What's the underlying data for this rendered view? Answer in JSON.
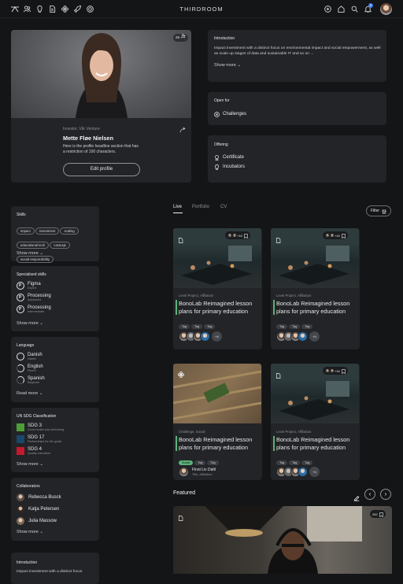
{
  "app": {
    "title": "THIRDROOM"
  },
  "nav": {
    "notification_count": "6"
  },
  "profile": {
    "badge": "28",
    "role": "Investor, Vår Venture",
    "name": "Mette Fløe Nielsen",
    "headline": "Here is the profile headline section that has a restriction of 100 characters.",
    "edit_label": "Edit profile"
  },
  "intro": {
    "title": "Introduction",
    "text": "Impact investment with a distinct focus on environmental impact and social empowerment, as well as scale up stages of data and sustainable IT and so on ...",
    "show_more": "Show more"
  },
  "open_for": {
    "title": "Open for",
    "items": [
      "Challenges"
    ]
  },
  "offering": {
    "title": "Offering",
    "items": [
      "Certificate",
      "Incubators"
    ]
  },
  "skills": {
    "title": "Skills",
    "tags": [
      "impact",
      "investment",
      "scaling",
      "educational tech",
      "cactusjs",
      "social responsibility"
    ],
    "show_more": "Show more"
  },
  "specialised": {
    "title": "Specialised skills",
    "items": [
      {
        "name": "Figma",
        "level": "Expert"
      },
      {
        "name": "Processing",
        "level": "Advanced"
      },
      {
        "name": "Processing",
        "level": "Intermediate"
      }
    ],
    "show_more": "Show more"
  },
  "language": {
    "title": "Language",
    "items": [
      {
        "name": "Danish",
        "level": "Native"
      },
      {
        "name": "English",
        "level": "Fluent"
      },
      {
        "name": "Spanish",
        "level": "Beginner"
      }
    ],
    "show_more": "Read more"
  },
  "sdg": {
    "title": "UN SDG Classification",
    "items": [
      {
        "name": "SDG 3",
        "desc": "Good health and well-being",
        "color": "#4c9f38"
      },
      {
        "name": "SDG 17",
        "desc": "Partnerships for the goals",
        "color": "#19486a"
      },
      {
        "name": "SDG 4",
        "desc": "Quality education",
        "color": "#c5192d"
      }
    ],
    "show_more": "Show more"
  },
  "collaborators": {
    "title": "Collaborators",
    "items": [
      "Rebecca Busck",
      "Katja Petersen",
      "Julia Massow"
    ],
    "show_more": "Show more"
  },
  "intro2": {
    "title": "Introduction",
    "text": "Impact investment with a distinct focus"
  },
  "tabs": [
    "Live",
    "Portfolio",
    "CV"
  ],
  "filter_label": "Filter",
  "projects": [
    {
      "type": "Level Project, Affiliation",
      "title": "BonoLab Reimagined lesson plans for primary education",
      "count": "+16",
      "tags": [
        "Tag",
        "Tag",
        "Tag"
      ],
      "more": "+4"
    },
    {
      "type": "Level Project, Affiliation",
      "title": "BonoLab Reimagined lesson plans for primary education",
      "count": "+16",
      "tags": [
        "Tag",
        "Tag",
        "Tag"
      ],
      "more": "+4"
    },
    {
      "type": "Challenge, Social",
      "title": "BonoLab Reimagined lesson plans for primary education",
      "tags": [
        "Social",
        "Tag",
        "Tag"
      ],
      "person": "Finst Liv Dahl",
      "person_sub": "Title, Affiliation"
    },
    {
      "type": "Level Project, Affiliation",
      "title": "BonoLab Reimagined lesson plans for primary education",
      "count": "+16",
      "tags": [
        "Tag",
        "Tag",
        "Tag"
      ],
      "more": "+4"
    }
  ],
  "featured": {
    "title": "Featured",
    "count": "282"
  },
  "colors": {
    "accent": "#5bb27b",
    "bg": "#141517",
    "card": "#222427"
  }
}
